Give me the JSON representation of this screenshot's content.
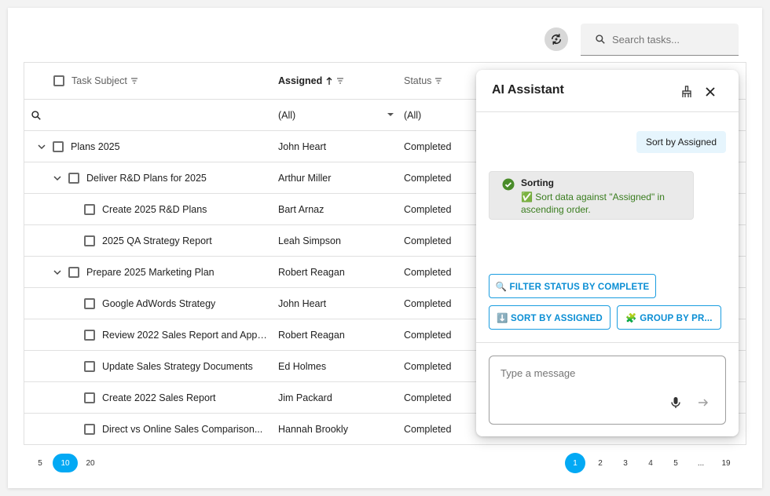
{
  "toolbar": {
    "search_placeholder": "Search tasks..."
  },
  "grid": {
    "columns": {
      "subject": "Task Subject",
      "assigned": "Assigned",
      "status": "Status"
    },
    "filter": {
      "assigned": "(All)",
      "status": "(All)"
    },
    "rows": [
      {
        "subject": "Plans 2025",
        "assigned": "John Heart",
        "status": "Completed",
        "level": 0,
        "expandable": true
      },
      {
        "subject": "Deliver R&D Plans for 2025",
        "assigned": "Arthur Miller",
        "status": "Completed",
        "level": 1,
        "expandable": true
      },
      {
        "subject": "Create 2025 R&D Plans",
        "assigned": "Bart Arnaz",
        "status": "Completed",
        "level": 2,
        "expandable": false
      },
      {
        "subject": "2025 QA Strategy Report",
        "assigned": "Leah Simpson",
        "status": "Completed",
        "level": 2,
        "expandable": false
      },
      {
        "subject": "Prepare 2025 Marketing Plan",
        "assigned": "Robert Reagan",
        "status": "Completed",
        "level": 1,
        "expandable": true
      },
      {
        "subject": "Google AdWords Strategy",
        "assigned": "John Heart",
        "status": "Completed",
        "level": 2,
        "expandable": false
      },
      {
        "subject": "Review 2022 Sales Report and Appr...",
        "assigned": "Robert Reagan",
        "status": "Completed",
        "level": 2,
        "expandable": false
      },
      {
        "subject": "Update Sales Strategy Documents",
        "assigned": "Ed Holmes",
        "status": "Completed",
        "level": 2,
        "expandable": false
      },
      {
        "subject": "Create 2022 Sales Report",
        "assigned": "Jim Packard",
        "status": "Completed",
        "level": 2,
        "expandable": false
      },
      {
        "subject": "Direct vs Online Sales Comparison...",
        "assigned": "Hannah Brookly",
        "status": "Completed",
        "level": 2,
        "expandable": false
      }
    ]
  },
  "pager": {
    "sizes": [
      "5",
      "10",
      "20"
    ],
    "active_size": "10",
    "pages": [
      "1",
      "2",
      "3",
      "4",
      "5",
      "...",
      "19"
    ],
    "active_page": "1"
  },
  "assistant": {
    "title": "AI Assistant",
    "user_message": "Sort by Assigned",
    "bot_title": "Sorting",
    "bot_text": "✅ Sort data against \"Assigned\" in ascending order.",
    "suggestions": [
      "🔍 FILTER STATUS BY COMPLETE",
      "⬇️ SORT BY ASSIGNED",
      "🧩 GROUP BY PR..."
    ],
    "input_placeholder": "Type a message"
  },
  "colors": {
    "accent": "#03a9f4",
    "success": "#4a8c2a",
    "suggestion_border": "#1a9de0"
  }
}
